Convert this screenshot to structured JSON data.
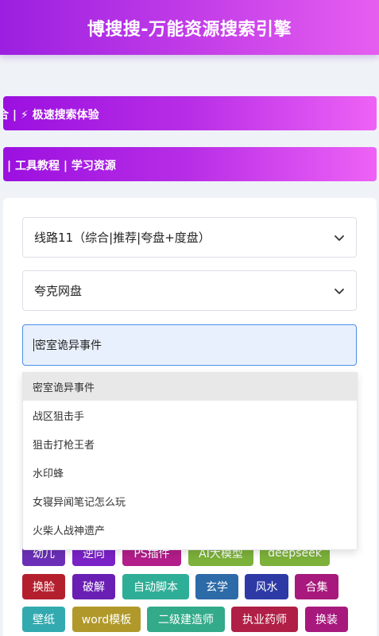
{
  "header": {
    "title": "博搜搜-万能资源搜索引擎"
  },
  "banners": [
    {
      "text": "合 | ⚡ 极速搜索体验"
    },
    {
      "text": "| 工具教程 | 学习资源"
    }
  ],
  "form": {
    "line_select": "线路11（综合|推荐|夸盘+度盘）",
    "disk_select": "夸克网盘",
    "search_value": "密室诡异事件"
  },
  "suggestions": [
    "密室诡异事件",
    "战区狙击手",
    "狙击打枪王者",
    "水印蜂",
    "女寝异闻笔记怎么玩",
    "火柴人战神遗产"
  ],
  "tags": [
    {
      "label": "幼儿",
      "color": "#6b2fb7"
    },
    {
      "label": "逆向",
      "color": "#7a22c6"
    },
    {
      "label": "PS插件",
      "color": "#b21e8a"
    },
    {
      "label": "AI大模型",
      "color": "#7cb13a"
    },
    {
      "label": "deepseek",
      "color": "#7cb13a"
    },
    {
      "label": "换脸",
      "color": "#b41f2e"
    },
    {
      "label": "破解",
      "color": "#6a1fb4"
    },
    {
      "label": "自动脚本",
      "color": "#2fae97"
    },
    {
      "label": "玄学",
      "color": "#2d6aa8"
    },
    {
      "label": "风水",
      "color": "#2d3aa6"
    },
    {
      "label": "合集",
      "color": "#a7197c"
    },
    {
      "label": "壁纸",
      "color": "#33aab0"
    },
    {
      "label": "word模板",
      "color": "#b0992a"
    },
    {
      "label": "二级建造师",
      "color": "#33aa8a"
    },
    {
      "label": "执业药师",
      "color": "#b01f45"
    },
    {
      "label": "换装",
      "color": "#a7197c"
    }
  ]
}
